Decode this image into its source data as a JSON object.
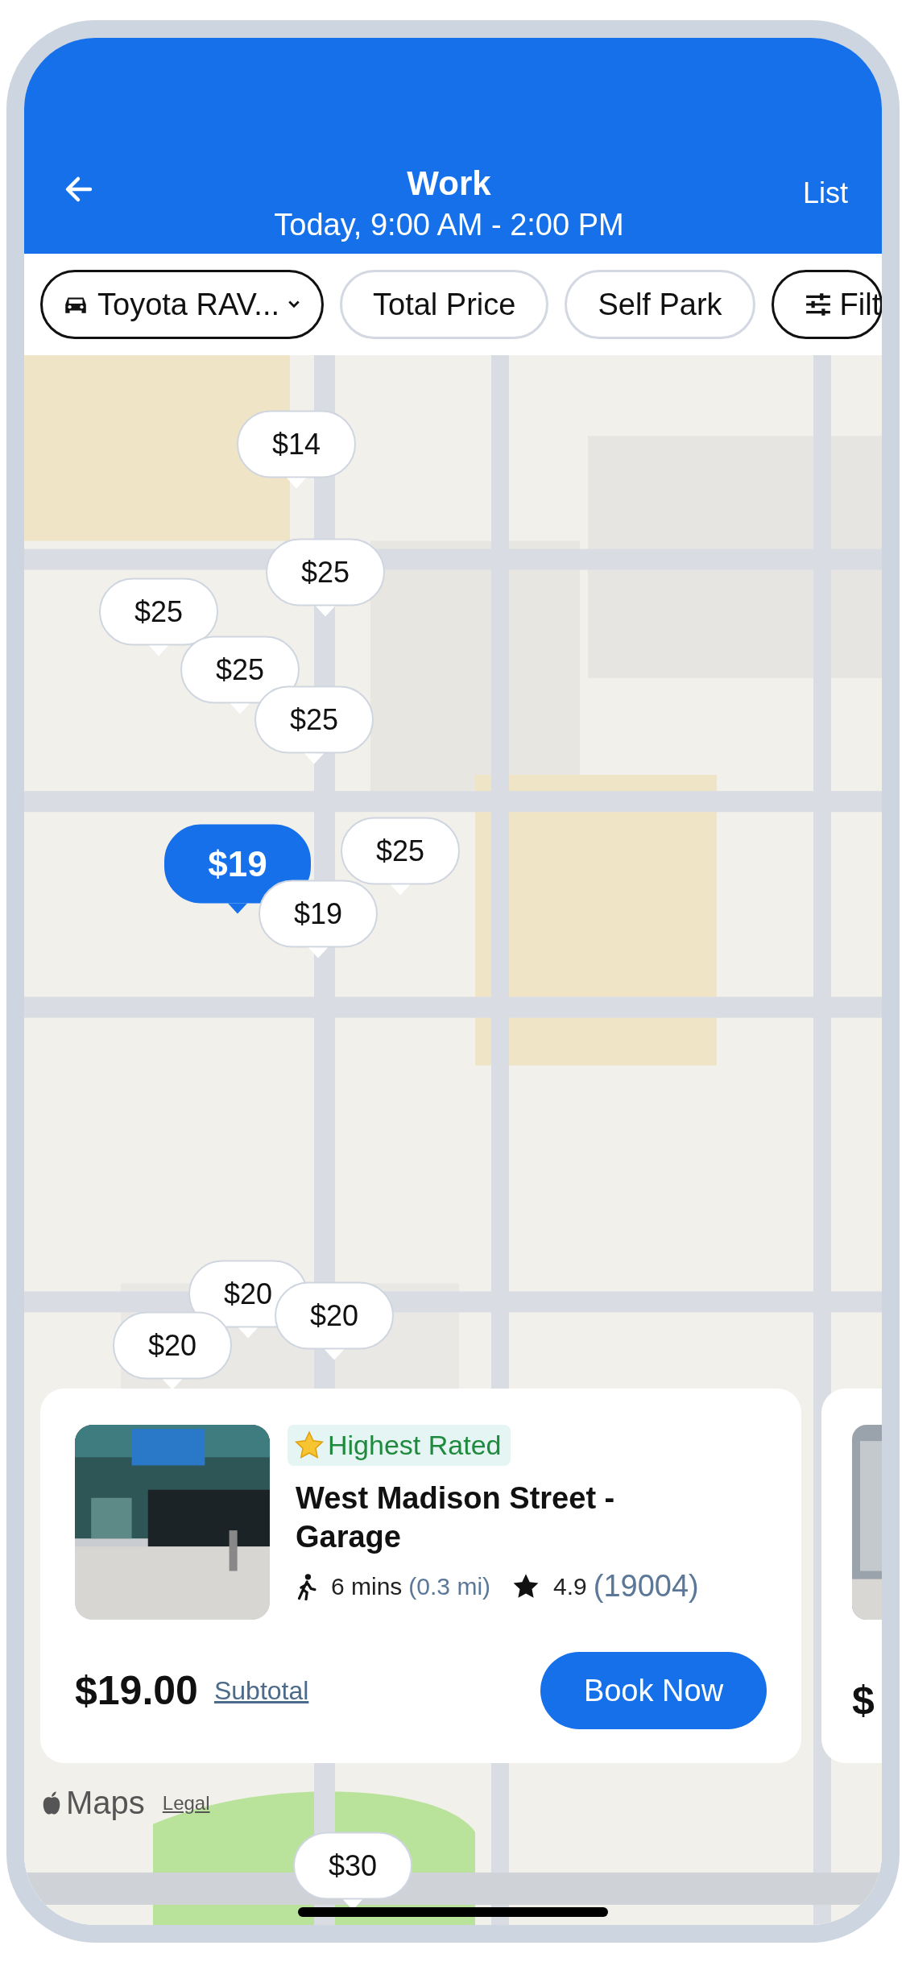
{
  "header": {
    "title": "Work",
    "subtitle": "Today,  9:00 AM - 2:00 PM",
    "action": "List"
  },
  "filters": [
    {
      "kind": "vehicle",
      "label": "Toyota RAV...",
      "selected": true
    },
    {
      "kind": "plain",
      "label": "Total Price",
      "selected": false
    },
    {
      "kind": "plain",
      "label": "Self Park",
      "selected": false
    },
    {
      "kind": "filters",
      "label": "Filt",
      "selected": true
    }
  ],
  "map": {
    "kind": "picture",
    "attribution": "Maps",
    "legal": "Legal",
    "pins": [
      {
        "label": "$14",
        "selected": false
      },
      {
        "label": "$25",
        "selected": false
      },
      {
        "label": "$25",
        "selected": false
      },
      {
        "label": "$25",
        "selected": false
      },
      {
        "label": "$25",
        "selected": false
      },
      {
        "label": "$25",
        "selected": false
      },
      {
        "label": "$19",
        "selected": true
      },
      {
        "label": "$19",
        "selected": false
      },
      {
        "label": "$20",
        "selected": false
      },
      {
        "label": "$20",
        "selected": false
      },
      {
        "label": "$20",
        "selected": false
      },
      {
        "label": "$30",
        "selected": false
      }
    ]
  },
  "card": {
    "badge": "Highest Rated",
    "title": "West Madison Street - Garage",
    "walk": "6 mins",
    "distance": "(0.3 mi)",
    "rating": "4.9",
    "reviews": "(19004)",
    "price": "$19.00",
    "price_note": "Subtotal",
    "button": "Book Now"
  },
  "next_card": {
    "price": "$"
  }
}
